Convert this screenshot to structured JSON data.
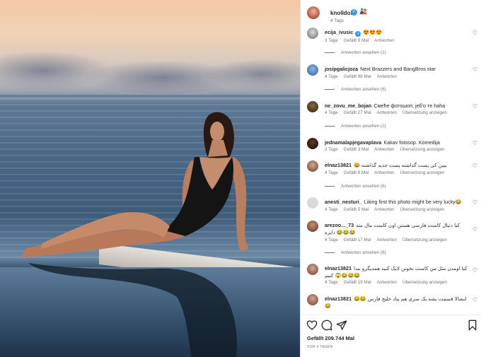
{
  "post": {
    "author": "knolldoll",
    "author_emoji": "🎎",
    "age": "4 Tags"
  },
  "comments": [
    {
      "user": "ecija_ivusic",
      "verified": true,
      "text": "😍😍😍",
      "age": "3 Tage",
      "likes": "Gefällt 9 Mal",
      "reply": "Antworten",
      "translate": "",
      "replies": "Antworten ansehen (1)"
    },
    {
      "user": "josipgalicjoza",
      "text": "Next Brazzers and BangBros star",
      "age": "4 Tage",
      "likes": "Gefällt 98 Mal",
      "reply": "Antworten",
      "translate": "",
      "replies": "Antworten ansehen (6)"
    },
    {
      "user": "ne_zovu_me_bojan",
      "text": "Смећe фотошоп, јеб'о те haha",
      "age": "4 Tage",
      "likes": "Gefällt 27 Mal",
      "reply": "Antworten",
      "translate": "Übersetzung anzeigen",
      "replies": "Antworten ansehen (2)"
    },
    {
      "user": "jednamalapjegavaplava",
      "text": "Kakav fotosop. Komedija",
      "age": "2 Tage",
      "likes": "Gefällt 3 Mal",
      "reply": "Antworten",
      "translate": "Übersetzung anzeigen",
      "replies": ""
    },
    {
      "user": "elnaz13821",
      "text": "😂 بیبن کی پست گذاشته پست جدید گذاشته",
      "age": "4 Tage",
      "likes": "Gefällt 8 Mal",
      "reply": "Antworten",
      "translate": "Übersetzung anzeigen",
      "replies": "Antworten ansehen (6)"
    },
    {
      "user": "anesti_nesturi_",
      "text": "Liking first this photo might be very lucky😂",
      "age": "4 Tage",
      "likes": "Gefällt 5 Mal",
      "reply": "Antworten",
      "translate": "Übersetzung anzeigen",
      "replies": ""
    },
    {
      "user": "arezoo..._73",
      "text": "کیا دنبال کامنت فارسی هستن اون کامنت مال منه دایره 😂😂😂",
      "age": "4 Tage",
      "likes": "Gefällt 17 Mal",
      "reply": "Antworten",
      "translate": "Übersetzung anzeigen",
      "replies": "Antworten ansehen (6)"
    },
    {
      "user": "elnaz13821",
      "text": "کیا اومدن مثل من کامنت بخونن لایک کنید همدیگرو ببدا 😂😂😂😱 کنیم",
      "age": "4 Tage",
      "likes": "Gefällt 19 Mal",
      "reply": "Antworten",
      "translate": "Übersetzung anzeigen",
      "replies": ""
    },
    {
      "user": "elnaz13821",
      "text": "😂😂 ایشالا قسمت بشه یک سری هم بیاد خلیج فارس 😂",
      "age": "",
      "likes": "",
      "reply": "",
      "translate": "",
      "replies": ""
    }
  ],
  "footer": {
    "likes": "Gefällt 209.744 Mal",
    "ago": "VOR 4 TAGEN"
  },
  "colors": {
    "verified": "#3797f0",
    "secondary_text": "#737373"
  },
  "icons": [
    "heart-icon",
    "comment-icon",
    "share-icon",
    "bookmark-icon",
    "verified-icon"
  ]
}
